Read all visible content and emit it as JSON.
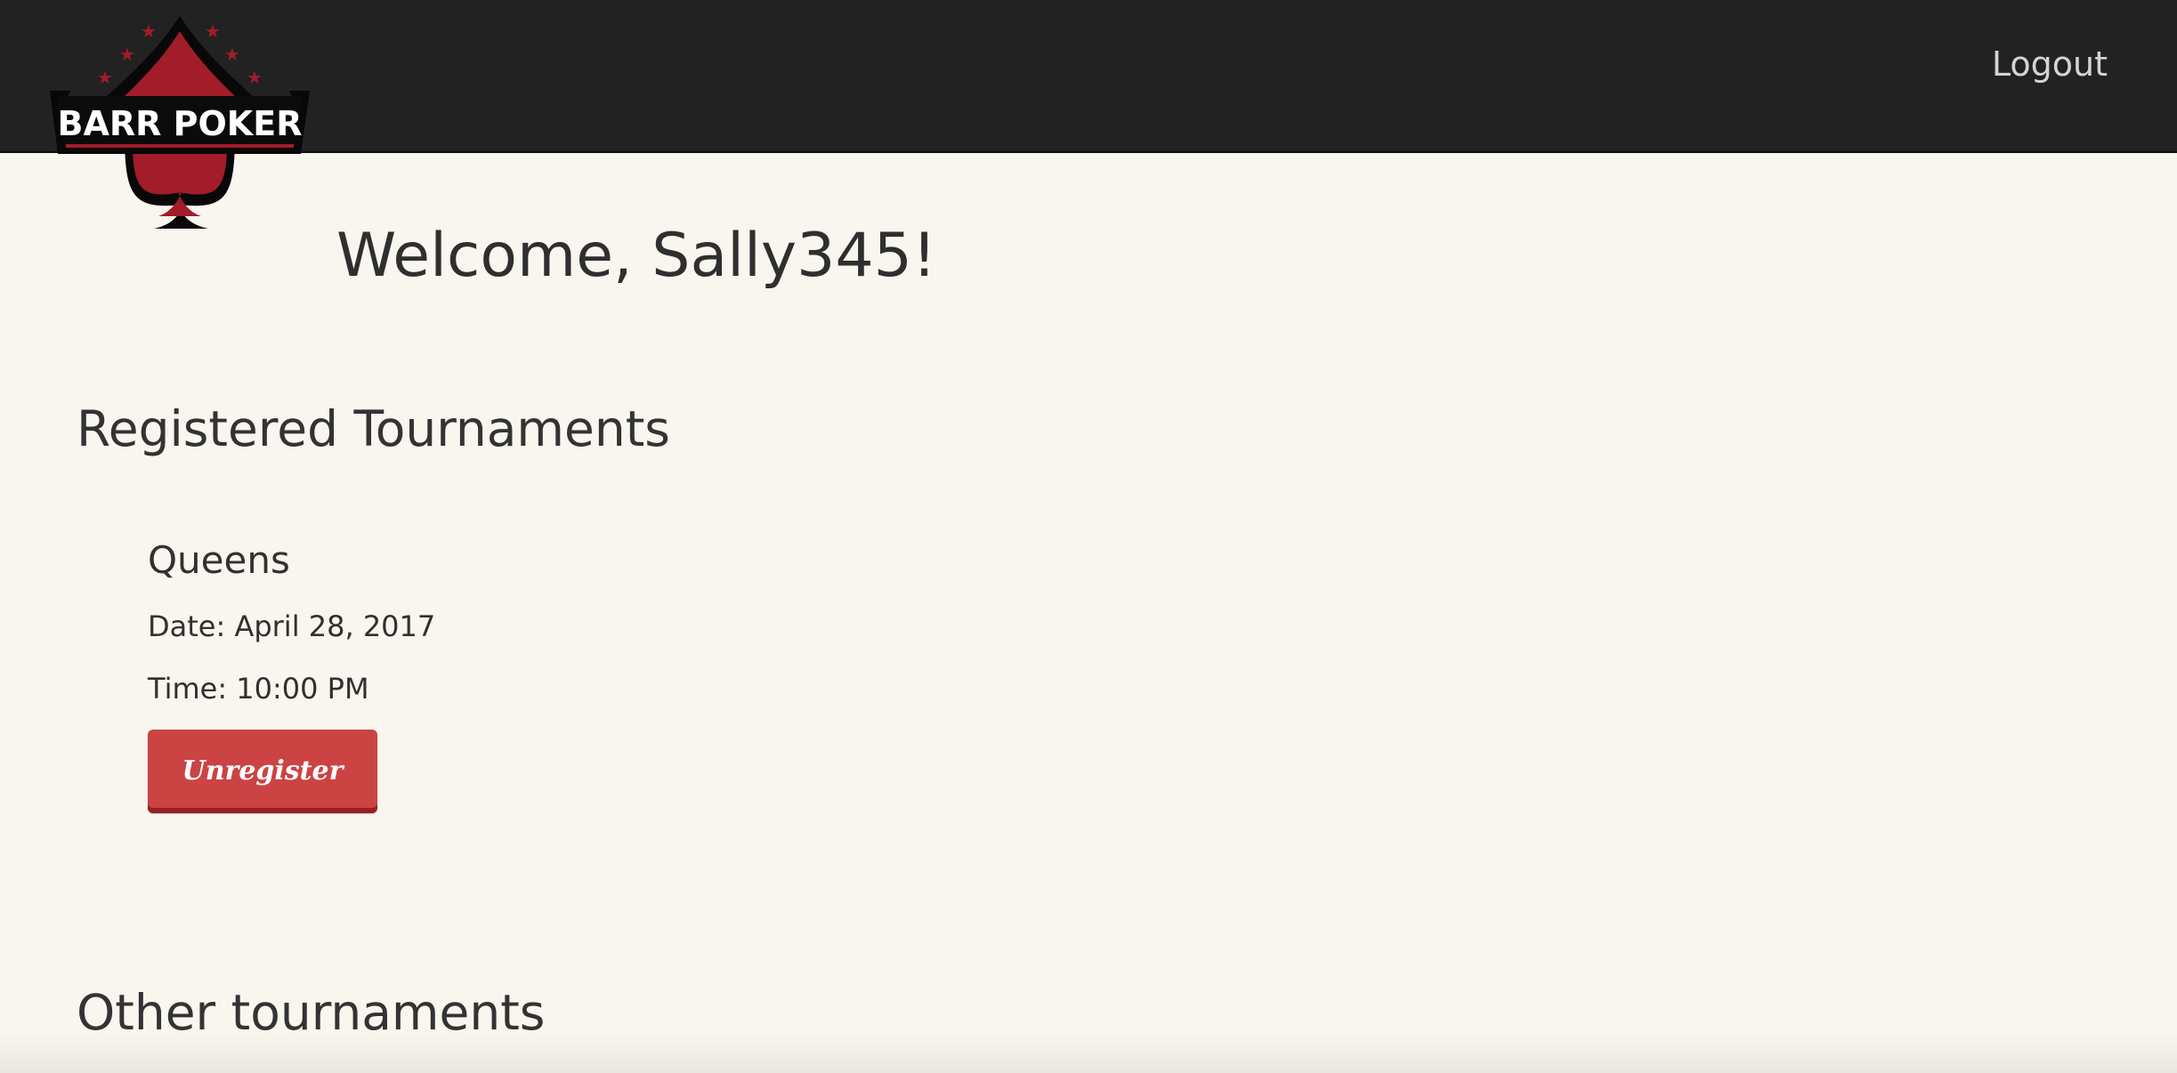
{
  "header": {
    "logo": {
      "text": "BARR POKER",
      "icon": "spade-icon"
    },
    "logout_label": "Logout"
  },
  "main": {
    "welcome": "Welcome, Sally345!",
    "registered_title": "Registered Tournaments",
    "registered_tournaments": [
      {
        "name": "Queens",
        "date": "Date: April 28, 2017",
        "time": "Time: 10:00 PM",
        "action_label": "Unregister"
      }
    ],
    "other_title": "Other tournaments"
  },
  "colors": {
    "header_background": "#222222",
    "page_background": "#f8f6ee",
    "brand_red": "#a51d2b",
    "button_red": "#cc4344",
    "logout_text": "#d4d4d4"
  }
}
